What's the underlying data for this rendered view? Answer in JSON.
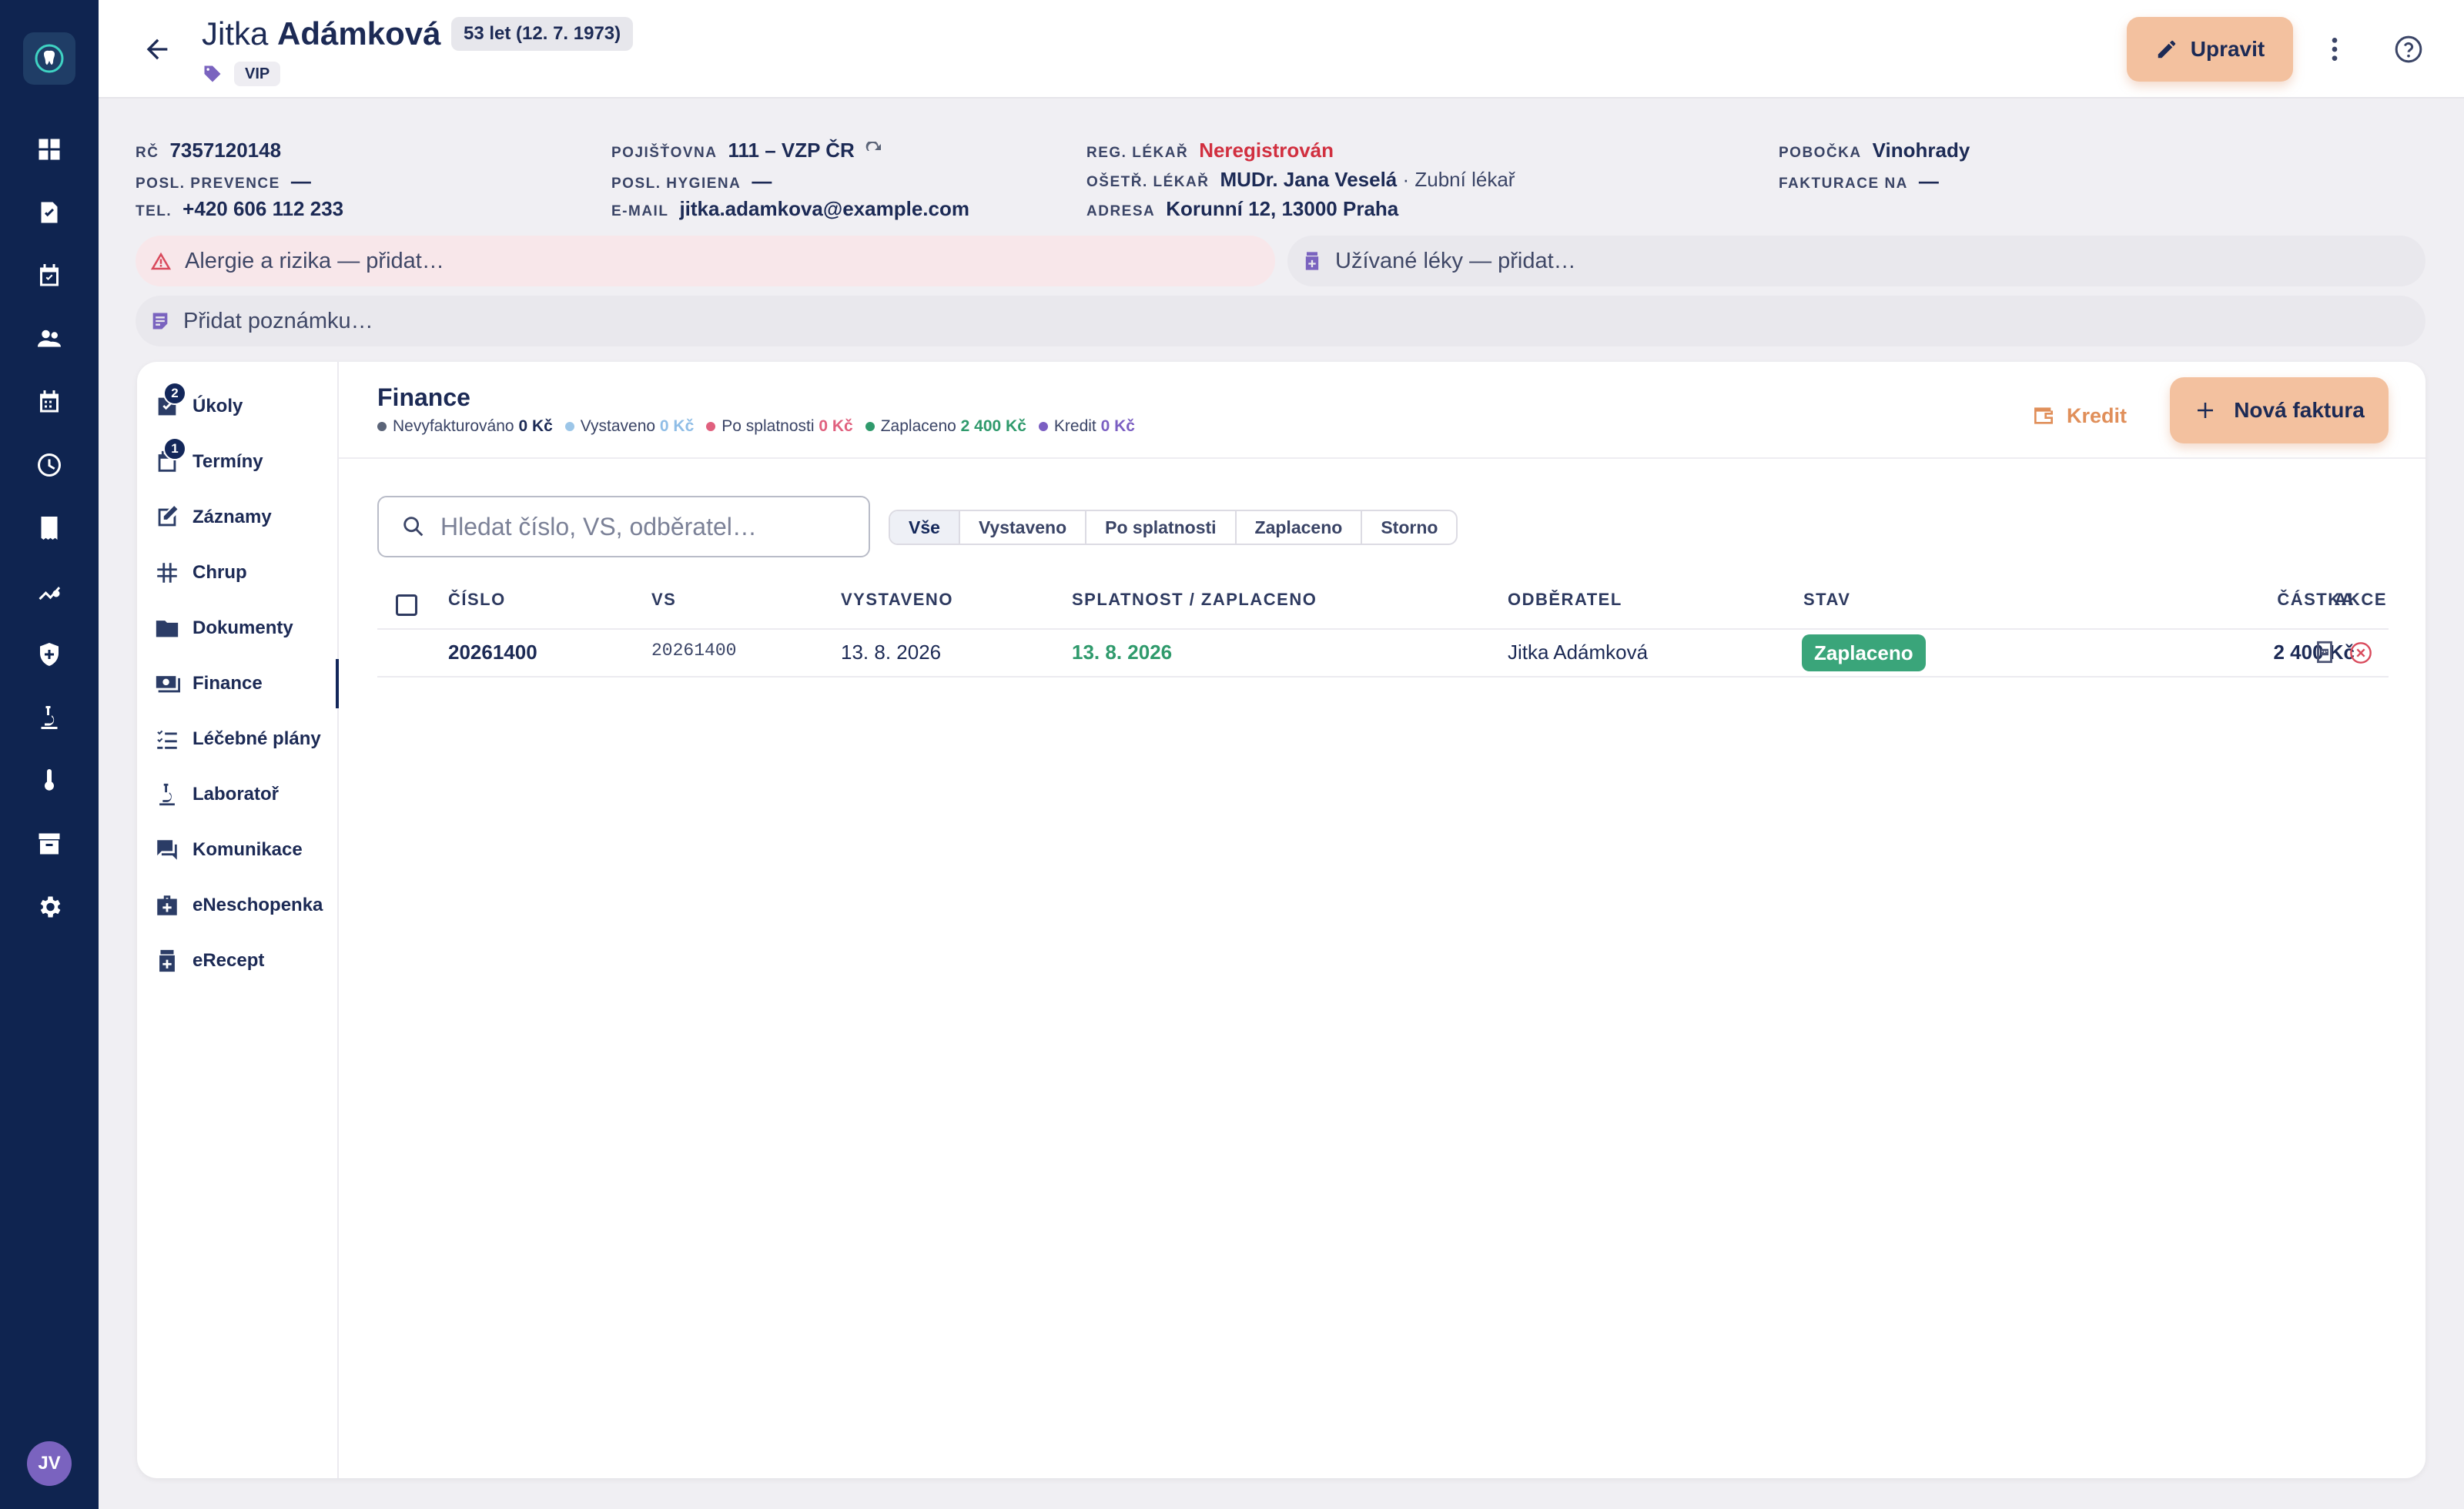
{
  "patient": {
    "first_name": "Jitka",
    "last_name": "Adámková",
    "age": "53 let (12. 7. 1973)",
    "tag": "VIP"
  },
  "header": {
    "edit_label": "Upravit"
  },
  "info": {
    "rc_label": "RČ",
    "rc": "7357120148",
    "prevence_label": "POSL. PREVENCE",
    "prevence": "—",
    "tel_label": "TEL.",
    "tel": "+420 606 112 233",
    "pojistovna_label": "POJIŠŤOVNA",
    "pojistovna": "111 – VZP ČR",
    "hygiena_label": "POSL. HYGIENA",
    "hygiena": "—",
    "email_label": "E-MAIL",
    "email": "jitka.adamkova@example.com",
    "reg_label": "REG. LÉKAŘ",
    "reg": "Neregistrován",
    "oset_label": "OŠETŘ. LÉKAŘ",
    "oset": "MUDr. Jana Veselá",
    "oset_role": "· Zubní lékař",
    "adresa_label": "ADRESA",
    "adresa": "Korunní 12, 13000 Praha",
    "pobocka_label": "POBOČKA",
    "pobocka": "Vinohrady",
    "fakturace_label": "FAKTURACE NA",
    "fakturace": "—"
  },
  "alerts": {
    "allergies": "Alergie a rizika — přidat…",
    "meds": "Užívané léky — přidat…",
    "note": "Přidat poznámku…"
  },
  "sidebar": {
    "items": [
      {
        "label": "Úkoly",
        "count": "2"
      },
      {
        "label": "Termíny",
        "count": "1"
      },
      {
        "label": "Záznamy"
      },
      {
        "label": "Chrup"
      },
      {
        "label": "Dokumenty"
      },
      {
        "label": "Finance"
      },
      {
        "label": "Léčebné plány"
      },
      {
        "label": "Laboratoř"
      },
      {
        "label": "Komunikace"
      },
      {
        "label": "eNeschopenka"
      },
      {
        "label": "eRecept"
      }
    ]
  },
  "finance": {
    "title": "Finance",
    "summary": [
      {
        "label": "Nevyfakturováno",
        "value": "0 Kč",
        "color": "#5b6478"
      },
      {
        "label": "Vystaveno",
        "value": "0 Kč",
        "color": "#9cc6e8"
      },
      {
        "label": "Po splatnosti",
        "value": "0 Kč",
        "color": "#e0607e"
      },
      {
        "label": "Zaplaceno",
        "value": "2 400 Kč",
        "color": "#2f9a6c"
      },
      {
        "label": "Kredit",
        "value": "0 Kč",
        "color": "#7b5fc2"
      }
    ],
    "kredit_label": "Kredit",
    "new_invoice_label": "Nová faktura",
    "search_placeholder": "Hledat číslo, VS, odběratel…",
    "filters": [
      "Vše",
      "Vystaveno",
      "Po splatnosti",
      "Zaplaceno",
      "Storno"
    ],
    "columns": {
      "cislo": "ČÍSLO",
      "vs": "VS",
      "vystaveno": "VYSTAVENO",
      "splatnost": "SPLATNOST / ZAPLACENO",
      "odberatel": "ODBĚRATEL",
      "stav": "STAV",
      "castka": "ČÁSTKA",
      "akce": "AKCE"
    },
    "rows": [
      {
        "cislo": "20261400",
        "vs": "20261400",
        "vystaveno": "13. 8. 2026",
        "splatnost": "13. 8. 2026",
        "odberatel": "Jitka Adámková",
        "stav": "Zaplaceno",
        "castka": "2 400 Kč"
      }
    ]
  },
  "user": {
    "initials": "JV"
  },
  "colors": {
    "rail": "#0f2450",
    "accent": "#f3c19f",
    "paid": "#3aa57a",
    "danger": "#d12f3f"
  }
}
